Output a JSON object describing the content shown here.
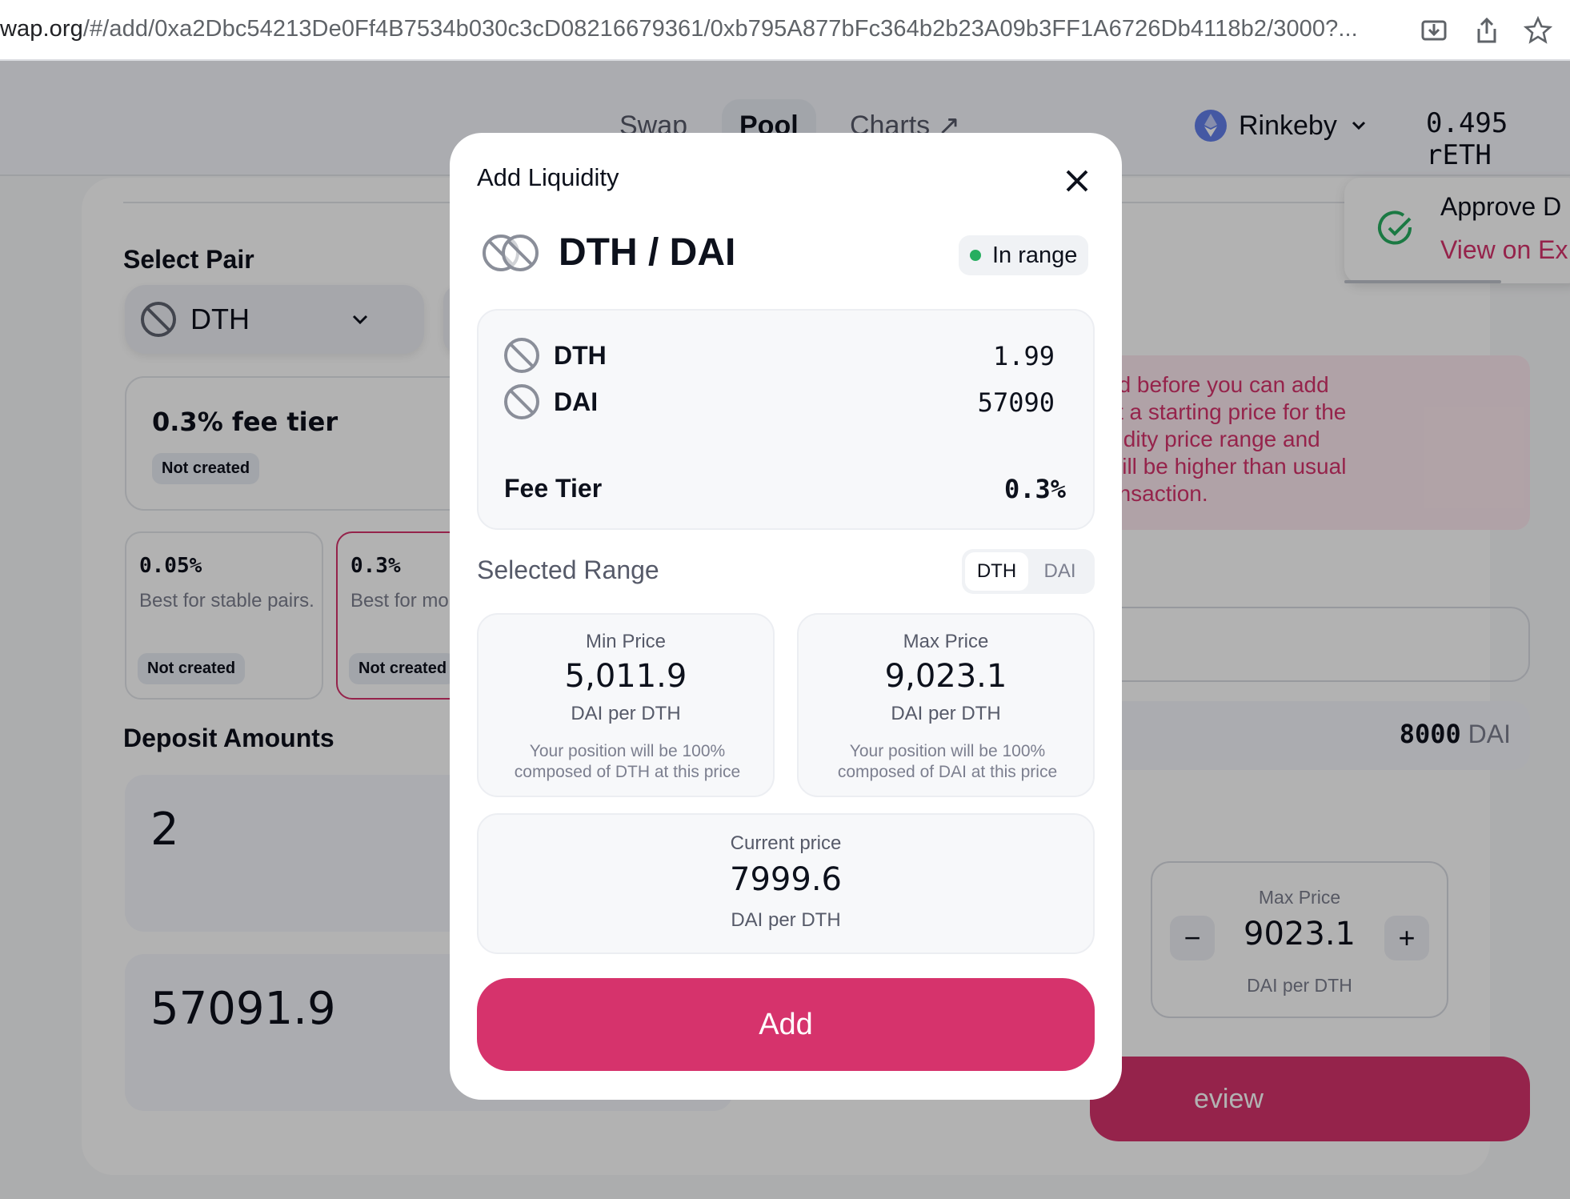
{
  "browser": {
    "url_host": "wap.org",
    "url_path": "/#/add/0xa2Dbc54213De0Ff4B7534b030c3cD08216679361/0xb795A877bFc364b2b23A09b3FF1A6726Db4118b2/3000?..."
  },
  "nav": {
    "tabs": [
      {
        "label": "Swap"
      },
      {
        "label": "Pool"
      },
      {
        "label": "Charts ↗"
      }
    ],
    "network": "Rinkeby",
    "balance": "0.495 rETH"
  },
  "background": {
    "select_pair_heading": "Select Pair",
    "token_a": "DTH",
    "fee_tier_title": "0.3% fee tier",
    "fee_tier_badge": "Not created",
    "tiers": [
      {
        "pct": "0.05%",
        "desc": "Best for stable pairs.",
        "badge": "Not created"
      },
      {
        "pct": "0.3%",
        "desc": "Best for mo pairs.",
        "badge": "Not created"
      }
    ],
    "deposit_heading": "Deposit Amounts",
    "deposit_a": "2",
    "deposit_b": "57091.9",
    "warning_lines": [
      "ed before you can add",
      "ct a starting price for the",
      "uidity price range and",
      "will be higher than usual",
      "ansaction."
    ],
    "starting_amount": "8000",
    "starting_unit": "DAI",
    "max_price_label": "Max Price",
    "max_price_value": "9023.1",
    "max_price_unit": "DAI per DTH",
    "review_label": "eview"
  },
  "toast": {
    "title": "Approve D",
    "link": "View on Ex"
  },
  "modal": {
    "title": "Add Liquidity",
    "pair": "DTH / DAI",
    "status": "In range",
    "token_a": {
      "symbol": "DTH",
      "amount": "1.99"
    },
    "token_b": {
      "symbol": "DAI",
      "amount": "57090"
    },
    "fee_tier_label": "Fee Tier",
    "fee_tier_value": "0.3%",
    "selected_range_label": "Selected Range",
    "toggle": [
      "DTH",
      "DAI"
    ],
    "min": {
      "label": "Min Price",
      "value": "5,011.9",
      "unit": "DAI per DTH",
      "note": "Your position will be 100% composed of DTH at this price"
    },
    "max": {
      "label": "Max Price",
      "value": "9,023.1",
      "unit": "DAI per DTH",
      "note": "Your position will be 100% composed of DAI at this price"
    },
    "current": {
      "label": "Current price",
      "value": "7999.6",
      "unit": "DAI per DTH"
    },
    "add_button": "Add"
  },
  "colors": {
    "accent": "#d6336c",
    "status_dot": "#27ae60"
  }
}
